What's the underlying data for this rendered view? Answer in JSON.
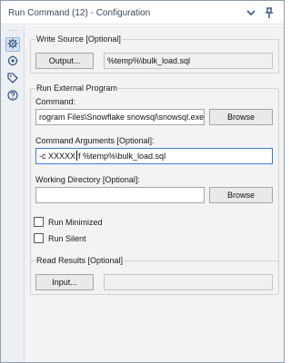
{
  "window": {
    "title": "Run Command (12) - Configuration"
  },
  "titlebar_icons": {
    "collapse": "chevron-down-icon",
    "pin": "pin-icon"
  },
  "rail": {
    "dots": "···",
    "items": [
      {
        "name": "configuration",
        "icon": "gear-icon",
        "active": true
      },
      {
        "name": "view",
        "icon": "eye-icon",
        "active": false
      },
      {
        "name": "annotation",
        "icon": "tag-icon",
        "active": false
      },
      {
        "name": "help",
        "icon": "help-icon",
        "active": false
      }
    ]
  },
  "write_source": {
    "legend": "Write Source [Optional]",
    "output_button": "Output...",
    "output_value": "%temp%\\bulk_load.sql"
  },
  "external_program": {
    "legend": "Run External Program",
    "command_label": "Command:",
    "command_value": "rogram Files\\Snowflake snowsql\\snowsql.exe",
    "command_browse": "Browse",
    "args_label": "Command Arguments [Optional]:",
    "args_value_before": "-c XXXXX",
    "args_value_after": "f %temp%\\bulk_load.sql",
    "workdir_label": "Working Directory [Optional]:",
    "workdir_value": "",
    "workdir_browse": "Browse",
    "run_minimized": "Run Minimized",
    "run_minimized_checked": false,
    "run_silent": "Run Silent",
    "run_silent_checked": false
  },
  "read_results": {
    "legend": "Read Results [Optional]",
    "input_button": "Input...",
    "input_value": ""
  },
  "colors": {
    "accent": "#3d7bd6",
    "title_text": "#3a4a5c",
    "panel_bg": "#f3f3f3",
    "rail_bg": "#eceff3"
  }
}
